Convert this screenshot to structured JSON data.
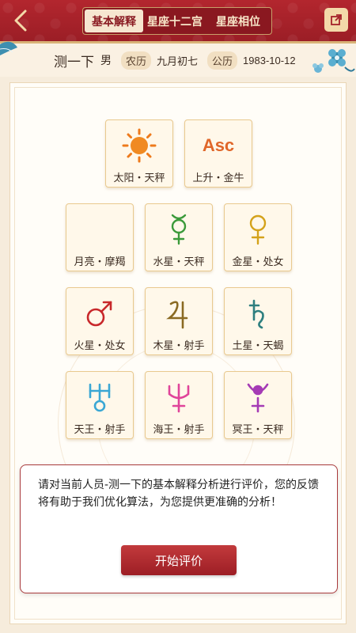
{
  "header": {
    "tabs": [
      {
        "label": "基本解释",
        "active": true
      },
      {
        "label": "星座十二宫",
        "active": false
      },
      {
        "label": "星座相位",
        "active": false
      }
    ]
  },
  "profile": {
    "name": "测一下",
    "gender": "男",
    "lunar_tag": "农历",
    "lunar_date": "九月初七",
    "solar_tag": "公历",
    "solar_date": "1983-10-12"
  },
  "planets": [
    {
      "label": "太阳・天秤",
      "icon": "sun-icon",
      "color": "#ee7a1c"
    },
    {
      "label": "上升・金牛",
      "icon": "asc-icon",
      "symbol": "Asc",
      "color": "#e0672a"
    },
    {
      "label": "月亮・摩羯",
      "icon": "moon-icon",
      "color": "#2b6fd4"
    },
    {
      "label": "水星・天秤",
      "icon": "mercury-icon",
      "color": "#3b9a3a"
    },
    {
      "label": "金星・处女",
      "icon": "venus-icon",
      "color": "#d4a21a"
    },
    {
      "label": "火星・处女",
      "icon": "mars-icon",
      "color": "#c8282b"
    },
    {
      "label": "木星・射手",
      "icon": "jupiter-icon",
      "color": "#8a6a22"
    },
    {
      "label": "土星・天蝎",
      "icon": "saturn-icon",
      "color": "#2e7f7f"
    },
    {
      "label": "天王・射手",
      "icon": "uranus-icon",
      "color": "#3aa7d4"
    },
    {
      "label": "海王・射手",
      "icon": "neptune-icon",
      "color": "#e0449a"
    },
    {
      "label": "冥王・天秤",
      "icon": "pluto-icon",
      "color": "#a53bb5"
    }
  ],
  "feedback": {
    "message": "请对当前人员-测一下的基本解释分析进行评价，您的反馈将有助于我们优化算法，为您提供更准确的分析！",
    "button_label": "开始评价"
  },
  "colors": {
    "header_red": "#a5212a",
    "accent_gold": "#d9b377",
    "button_red": "#b02c31"
  }
}
